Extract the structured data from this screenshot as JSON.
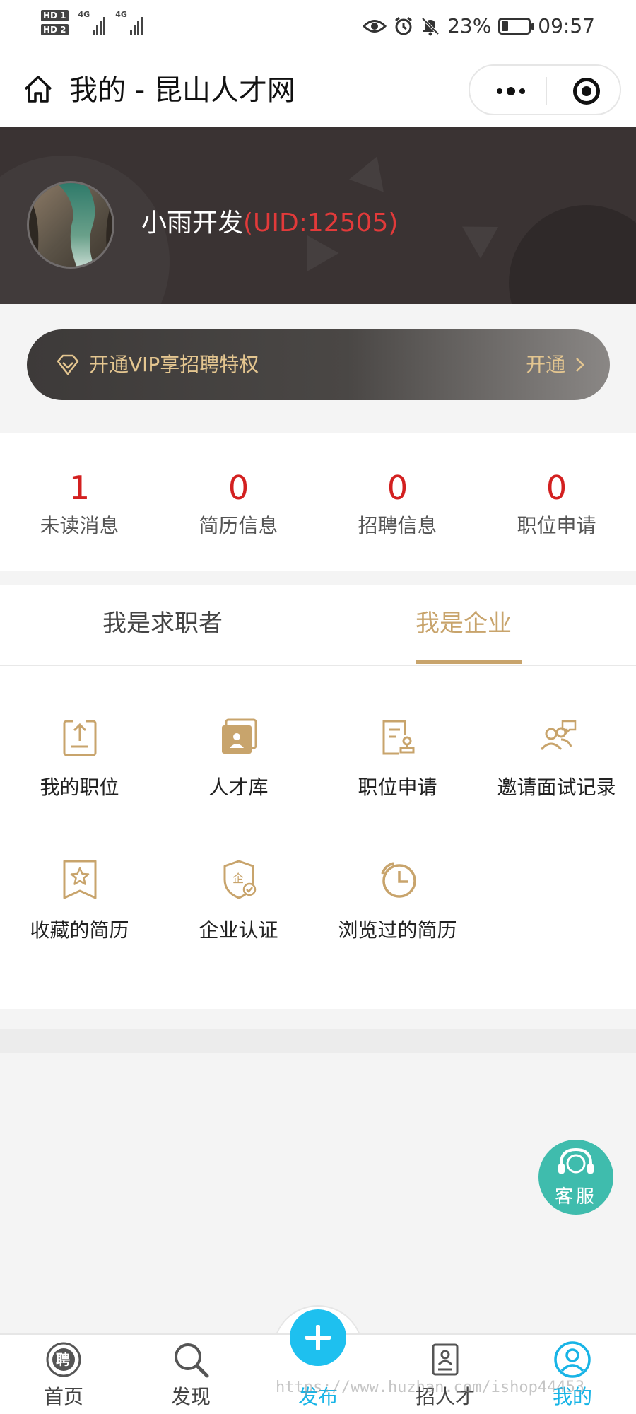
{
  "status_bar": {
    "sim1": "HD 1",
    "sim2": "HD 2",
    "network1": "4G",
    "network2": "4G",
    "battery_percent_text": "23%",
    "battery_level": 0.23,
    "time": "09:57",
    "icons": [
      "eye-icon",
      "alarm-icon",
      "bell-muted-icon",
      "battery-icon"
    ]
  },
  "nav": {
    "title": "我的 - 昆山人才网",
    "home_icon": "home-icon",
    "more_icon": "more-dots-icon",
    "close_icon": "target-icon"
  },
  "profile": {
    "name": "小雨开发",
    "uid": "(UID:12505)",
    "name_color": "#ffffff",
    "uid_color": "#e23a3a"
  },
  "vip": {
    "text": "开通VIP享招聘特权",
    "action": "开通",
    "accent": "#e4c690"
  },
  "stats": [
    {
      "value": "1",
      "label": "未读消息"
    },
    {
      "value": "0",
      "label": "简历信息"
    },
    {
      "value": "0",
      "label": "招聘信息"
    },
    {
      "value": "0",
      "label": "职位申请"
    }
  ],
  "tabs": {
    "jobseeker": "我是求职者",
    "company": "我是企业",
    "active": "company",
    "active_color": "#c8a46c"
  },
  "menu": [
    {
      "label": "我的职位",
      "icon": "upload-doc-icon"
    },
    {
      "label": "人才库",
      "icon": "talent-card-icon"
    },
    {
      "label": "职位申请",
      "icon": "application-stamp-icon"
    },
    {
      "label": "邀请面试记录",
      "icon": "interview-people-icon"
    },
    {
      "label": "收藏的简历",
      "icon": "star-bookmark-icon"
    },
    {
      "label": "企业认证",
      "icon": "company-shield-icon"
    },
    {
      "label": "浏览过的简历",
      "icon": "history-clock-icon"
    }
  ],
  "customer_service": {
    "label": "客服",
    "icon": "headset-icon",
    "color": "#3fbcad"
  },
  "tabbar": [
    {
      "label": "首页",
      "icon": "home-hire-icon",
      "active": false
    },
    {
      "label": "发现",
      "icon": "search-icon",
      "active": false
    },
    {
      "label": "发布",
      "icon": "plus-icon",
      "active": false
    },
    {
      "label": "招人才",
      "icon": "resume-icon",
      "active": false
    },
    {
      "label": "我的",
      "icon": "user-icon",
      "active": true
    }
  ],
  "watermark": "https://www.huzhan.com/ishop44453"
}
